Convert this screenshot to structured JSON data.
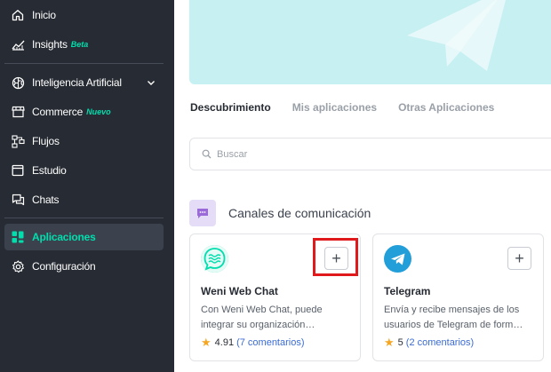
{
  "sidebar": {
    "items": [
      {
        "label": "Inicio",
        "icon": "home-icon"
      },
      {
        "label": "Insights",
        "badge": "Beta",
        "badge_color": "#00dead",
        "icon": "chart-icon"
      },
      {
        "label": "Inteligencia Artificial",
        "icon": "brain-icon"
      },
      {
        "label": "Commerce",
        "badge": "Nuevo",
        "badge_color": "#00dead",
        "icon": "store-icon"
      },
      {
        "label": "Flujos",
        "icon": "flow-icon"
      },
      {
        "label": "Estudio",
        "icon": "window-icon"
      },
      {
        "label": "Chats",
        "icon": "chat-icon"
      },
      {
        "label": "Aplicaciones",
        "icon": "apps-icon",
        "active": true
      },
      {
        "label": "Configuración",
        "icon": "gear-icon"
      }
    ]
  },
  "tabs": [
    "Descubrimiento",
    "Mis aplicaciones",
    "Otras Aplicaciones"
  ],
  "search": {
    "placeholder": "Buscar"
  },
  "section": {
    "title": "Canales de comunicación"
  },
  "cards": [
    {
      "name": "Weni Web Chat",
      "description": "Con Weni Web Chat, puede integrar su organización…",
      "rating": "4.91",
      "comments": "(7 comentarios)",
      "add": "+"
    },
    {
      "name": "Telegram",
      "description": "Envía y recibe mensajes de los usuarios de Telegram de form…",
      "rating": "5",
      "comments": "(2 comentarios)",
      "add": "+"
    }
  ],
  "colors": {
    "sidebar_bg": "#272b33",
    "accent": "#00dead",
    "banner": "#c7f0f2",
    "highlight": "#e0191d",
    "telegram": "#229ed9",
    "webchat": "#00dead"
  }
}
